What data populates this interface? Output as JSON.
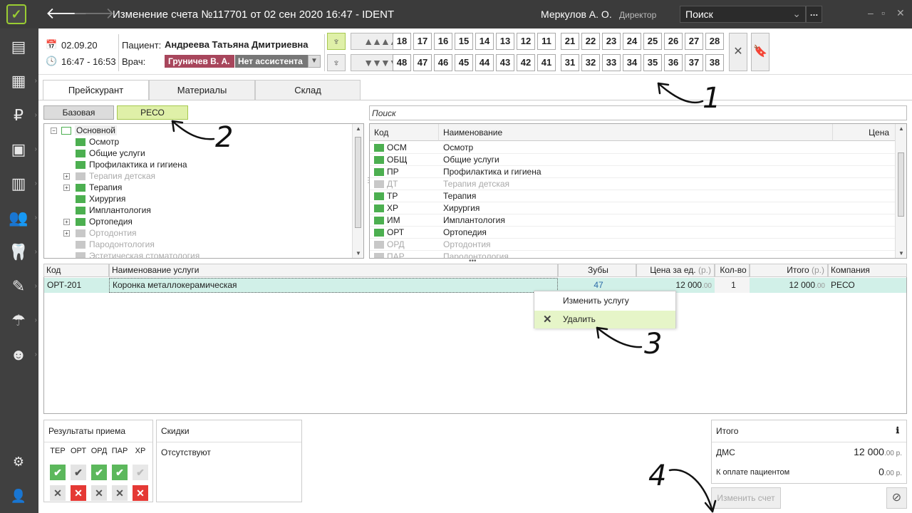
{
  "window": {
    "title": "Изменение счета №117701 от 02 сен 2020 16:47  -  IDENT",
    "user": "Меркулов А. О.",
    "role": "Директор",
    "search_placeholder": "Поиск"
  },
  "header": {
    "date": "02.09.20",
    "time": "16:47 - 16:53",
    "patient_label": "Пациент:",
    "patient_name": "Андреева Татьяна Дмитриевна",
    "doctor_label": "Врач:",
    "doctor_name": "Груничев В. А.",
    "assistant": "Нет ассистента"
  },
  "teeth": {
    "upper": [
      "18",
      "17",
      "16",
      "15",
      "14",
      "13",
      "12",
      "11",
      "21",
      "22",
      "23",
      "24",
      "25",
      "26",
      "27",
      "28"
    ],
    "lower": [
      "48",
      "47",
      "46",
      "45",
      "44",
      "43",
      "42",
      "41",
      "31",
      "32",
      "33",
      "34",
      "35",
      "36",
      "37",
      "38"
    ]
  },
  "tabs": [
    "Прейскурант",
    "Материалы",
    "Склад"
  ],
  "price_lists": [
    "Базовая",
    "РЕСО"
  ],
  "search_placeholder": "Поиск",
  "tree": [
    {
      "label": "Основной",
      "state": "open",
      "level": 0
    },
    {
      "label": "Осмотр",
      "state": "green",
      "level": 1
    },
    {
      "label": "Общие услуги",
      "state": "green",
      "level": 1
    },
    {
      "label": "Профилактика и гигиена",
      "state": "green",
      "level": 1
    },
    {
      "label": "Терапия детская",
      "state": "grey",
      "level": 1,
      "expand": true
    },
    {
      "label": "Терапия",
      "state": "green",
      "level": 1,
      "expand": true
    },
    {
      "label": "Хирургия",
      "state": "green",
      "level": 1
    },
    {
      "label": "Имплантология",
      "state": "green",
      "level": 1
    },
    {
      "label": "Ортопедия",
      "state": "green",
      "level": 1,
      "expand": true
    },
    {
      "label": "Ортодонтия",
      "state": "grey",
      "level": 1,
      "expand": true
    },
    {
      "label": "Пародонтология",
      "state": "grey",
      "level": 1
    },
    {
      "label": "Эстетическая стоматология",
      "state": "grey",
      "level": 1
    }
  ],
  "codes_table": {
    "headers": [
      "Код",
      "Наименование",
      "Цена"
    ],
    "rows": [
      {
        "code": "ОСМ",
        "name": "Осмотр",
        "state": "green"
      },
      {
        "code": "ОБЩ",
        "name": "Общие услуги",
        "state": "green"
      },
      {
        "code": "ПР",
        "name": "Профилактика и гигиена",
        "state": "green"
      },
      {
        "code": "ДТ",
        "name": "Терапия детская",
        "state": "grey"
      },
      {
        "code": "ТР",
        "name": "Терапия",
        "state": "green"
      },
      {
        "code": "ХР",
        "name": "Хирургия",
        "state": "green"
      },
      {
        "code": "ИМ",
        "name": "Имплантология",
        "state": "green"
      },
      {
        "code": "ОРТ",
        "name": "Ортопедия",
        "state": "green"
      },
      {
        "code": "ОРД",
        "name": "Ортодонтия",
        "state": "grey"
      },
      {
        "code": "ПАР",
        "name": "Пародонтология",
        "state": "grey"
      }
    ]
  },
  "services": {
    "headers": {
      "code": "Код",
      "name": "Наименование услуги",
      "teeth": "Зубы",
      "price": "Цена за ед.",
      "price_unit": "(р.)",
      "qty": "Кол-во",
      "total": "Итого",
      "total_unit": "(р.)",
      "company": "Компания"
    },
    "row": {
      "code": "ОРТ-201",
      "name": "Коронка металлокерамическая",
      "teeth": "47",
      "price": "12 000",
      "price_kop": ".00",
      "qty": "1",
      "total": "12 000",
      "total_kop": ".00",
      "company": "РЕСО"
    }
  },
  "context_menu": {
    "edit": "Изменить услугу",
    "delete": "Удалить"
  },
  "results": {
    "title": "Результаты приема",
    "columns": [
      "ТЕР",
      "ОРТ",
      "ОРД",
      "ПАР",
      "ХР"
    ]
  },
  "discounts": {
    "title": "Скидки",
    "value": "Отсутствуют"
  },
  "totals": {
    "title": "Итого",
    "dms_label": "ДМС",
    "dms_value": "12 000",
    "dms_kop": ".00 р.",
    "pay_label": "К оплате пациентом",
    "pay_value": "0",
    "pay_kop": ".00 р."
  },
  "change_button": "Изменить счет",
  "annotations": [
    "1",
    "2",
    "3",
    "4"
  ]
}
